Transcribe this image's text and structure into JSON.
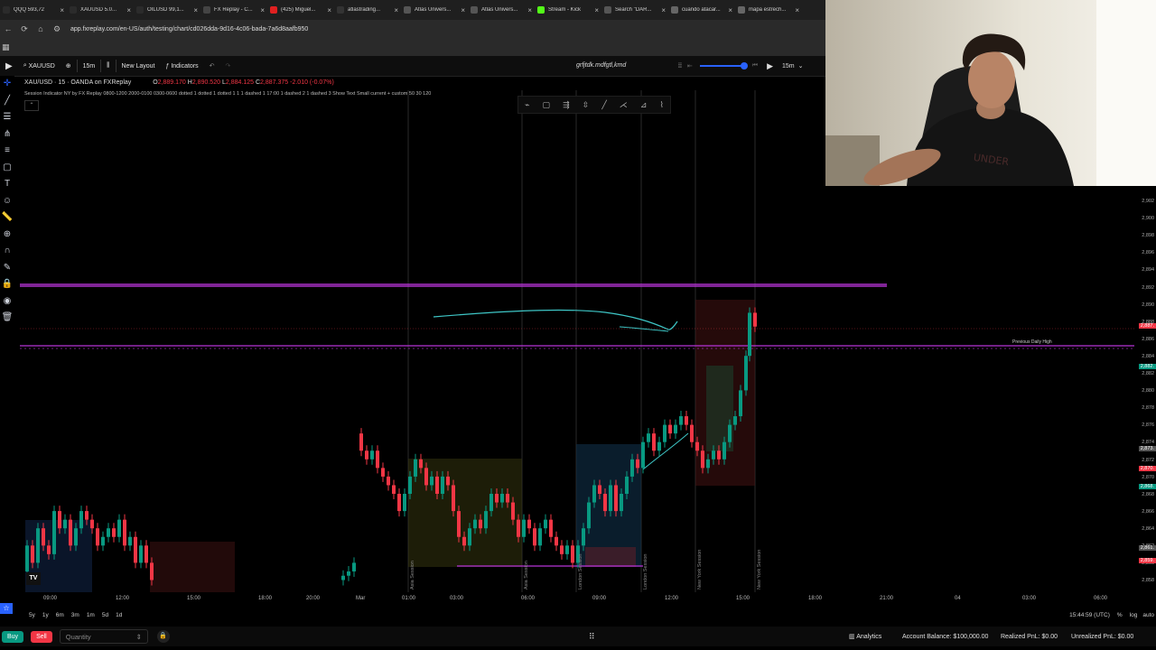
{
  "tabs": [
    {
      "label": "QQQ 593,72",
      "fav": "#2b2b2b",
      "icon": "tv-logo-icon"
    },
    {
      "label": "XAUUSD 5.0...",
      "fav": "#2b2b2b",
      "icon": "tv-logo-icon"
    },
    {
      "label": "OILUSD 99,1...",
      "fav": "#2b2b2b",
      "icon": "tv-logo-icon"
    },
    {
      "label": "FX Replay - C...",
      "fav": "#444",
      "icon": "fxreplay-icon"
    },
    {
      "label": "(425) Miguel...",
      "fav": "#e02020",
      "icon": "youtube-icon"
    },
    {
      "label": "atlastrading...",
      "fav": "#333",
      "icon": "tiktok-icon"
    },
    {
      "label": "Atlas Univers...",
      "fav": "#555",
      "icon": "atlas-icon"
    },
    {
      "label": "Atlas Univers...",
      "fav": "#555",
      "icon": "atlas-icon"
    },
    {
      "label": "Stream - Kick",
      "fav": "#53fc18",
      "icon": "kick-icon"
    },
    {
      "label": "Search \"DAR...",
      "fav": "#555",
      "icon": "search-icon"
    },
    {
      "label": "cuando atacar...",
      "fav": "#666",
      "icon": "globe-icon"
    },
    {
      "label": "mapa estrech...",
      "fav": "#666",
      "icon": "globe-icon"
    }
  ],
  "url": "app.fxreplay.com/en-US/auth/testing/chart/cd026dda-9d16-4c06-bada-7a6d8aafb950",
  "toolbar": {
    "symbol": "XAUUSD",
    "interval": "15m",
    "layout": "New Layout",
    "indicators": "Indicators",
    "title": "grfjtdk.mdfgtl,kmd",
    "speed": "15m"
  },
  "legend": {
    "symbol": "XAU/USD · 15 · OANDA on FXReplay",
    "o": "2,889.170",
    "h": "2,890.520",
    "l": "2,884.125",
    "c": "2,887.375",
    "chg": "-2.010 (-0.07%)",
    "indicator": "Session Indicator NY by FX Replay 0800-1200 2000-0100 0300-0600 dotted 1 dotted 1 dotted 1 1 1 dashed 1 17:00 1 dashed 2 1 dashed 3 Show Text Small current + custom 50 30 120"
  },
  "price_labels": [
    "2,902",
    "2,900",
    "2,898",
    "2,896",
    "2,894",
    "2,892",
    "2,890",
    "2,888",
    "2,886",
    "2,884",
    "2,882",
    "2,880",
    "2,878",
    "2,876",
    "2,874",
    "2,872",
    "2,870",
    "2,868",
    "2,866",
    "2,864",
    "2,862",
    "2,860",
    "2,858"
  ],
  "price_tags": [
    {
      "label": "2,887.",
      "color": "#f23645"
    },
    {
      "label": "2,882.",
      "color": "#089981"
    },
    {
      "label": "2,873.",
      "color": "#555"
    },
    {
      "label": "2,870.",
      "color": "#f23645"
    },
    {
      "label": "2,868.",
      "color": "#089981"
    },
    {
      "label": "2,861.",
      "color": "#555"
    },
    {
      "label": "2,859.",
      "color": "#f23645"
    }
  ],
  "time_labels": [
    "09:00",
    "12:00",
    "15:00",
    "18:00",
    "20:00",
    "Mar",
    "01:00",
    "03:00",
    "06:00",
    "09:00",
    "12:00",
    "15:00",
    "18:00",
    "21:00",
    "04",
    "03:00",
    "06:00"
  ],
  "sessions": [
    "Asia Session",
    "Asia Session",
    "London Session",
    "London Session",
    "New York Session",
    "New York Session"
  ],
  "prev_daily_high": "Previous Daily High",
  "ranges": [
    "5y",
    "1y",
    "6m",
    "3m",
    "1m",
    "5d",
    "1d"
  ],
  "clock": "15:44:59 (UTC)",
  "axis_modes": [
    "%",
    "log",
    "auto"
  ],
  "trade": {
    "buy": "Buy",
    "sell": "Sell",
    "qty_placeholder": "Quantity",
    "analytics": "Analytics",
    "balance": "Account Balance: $100,000.00",
    "realized": "Realized PnL: $0.00",
    "unrealized": "Unrealized PnL: $0.00"
  },
  "colors": {
    "bull": "#089981",
    "bear": "#f23645",
    "level": "#b733d6",
    "accent": "#2962ff"
  }
}
